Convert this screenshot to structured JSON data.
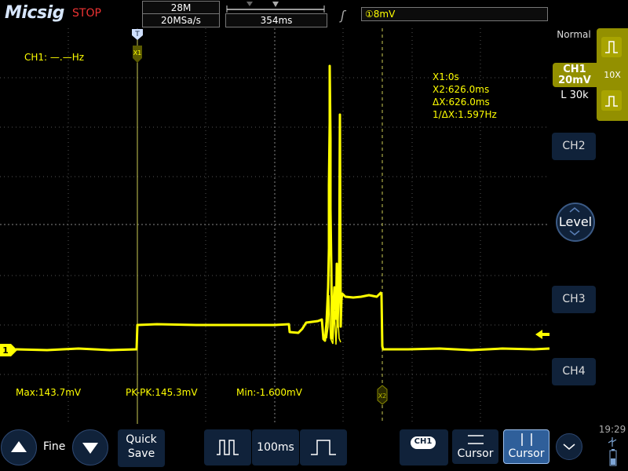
{
  "header": {
    "logo": "Micsig",
    "run_state": "STOP",
    "memory_depth": "28M",
    "sample_rate": "20MSa/s",
    "time_position": "354ms",
    "trigger_level": "①8mV"
  },
  "measurements": {
    "frequency": "CH1: —.—Hz",
    "max": "Max:143.7mV",
    "pk_pk": "PK-PK:145.3mV",
    "min": "Min:-1.600mV"
  },
  "cursors": {
    "x1_label": "X1",
    "x2_label": "X2",
    "x1": "X1:0s",
    "x2": "X2:626.0ms",
    "dx": "ΔX:626.0ms",
    "inv_dx": "1/ΔX:1.597Hz"
  },
  "channel_marker": "1",
  "trigger_marker": "T",
  "right_panel": {
    "mode": "Normal",
    "ch1_name": "CH1",
    "ch1_scale": "20mV",
    "probe": "10X",
    "coupling": "L 30k",
    "ch2": "CH2",
    "level": "Level",
    "ch3": "CH3",
    "ch4": "CH4"
  },
  "bottom_bar": {
    "fine": "Fine",
    "quick_save_line1": "Quick",
    "quick_save_line2": "Save",
    "timebase": "100ms",
    "ch1_badge": "CH1",
    "cursor_h": "Cursor",
    "cursor_v": "Cursor",
    "clock": "19:29"
  },
  "colors": {
    "trace": "#ffff00",
    "accent_panel": "#939000",
    "button_bg": "#10223a",
    "stop": "#e33333"
  }
}
